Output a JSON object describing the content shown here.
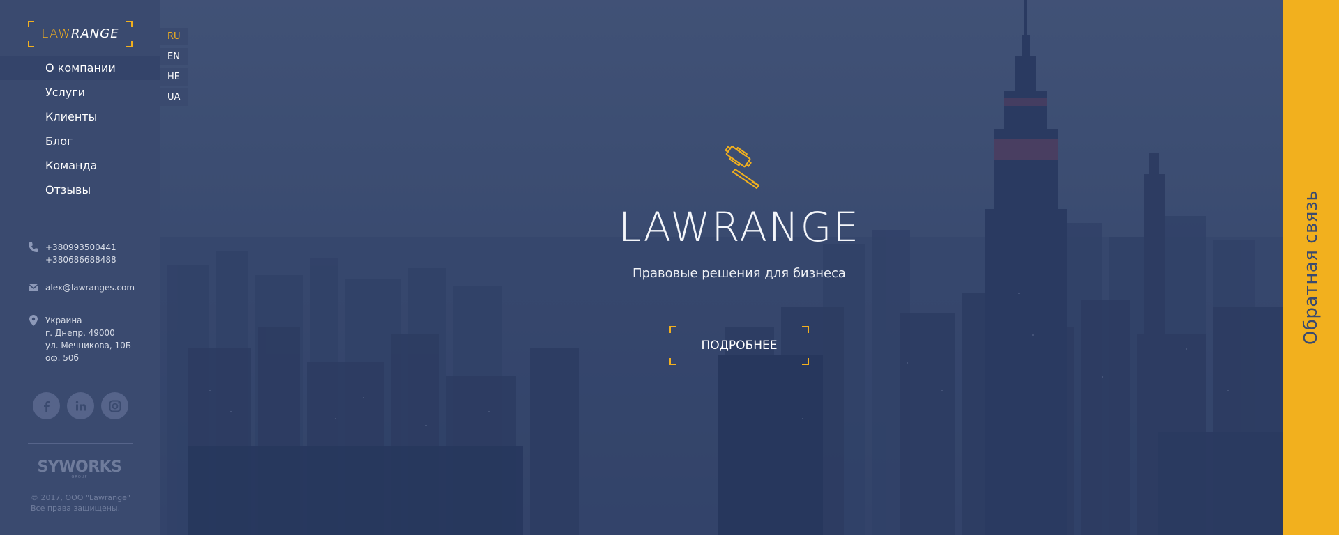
{
  "logo": {
    "part1": "LAW",
    "part2": "RANGE"
  },
  "nav": {
    "items": [
      {
        "label": "О компании",
        "active": true
      },
      {
        "label": "Услуги"
      },
      {
        "label": "Клиенты"
      },
      {
        "label": "Блог"
      },
      {
        "label": "Команда"
      },
      {
        "label": "Отзывы"
      }
    ]
  },
  "languages": [
    {
      "code": "RU",
      "active": true
    },
    {
      "code": "EN"
    },
    {
      "code": "HE"
    },
    {
      "code": "UA"
    }
  ],
  "contacts": {
    "phone1": "+380993500441",
    "phone2": "+380686688488",
    "email": "alex@lawranges.com",
    "address": [
      "Украина",
      "г. Днепр, 49000",
      "ул. Мечникова, 10Б",
      "оф. 50б"
    ]
  },
  "social": [
    {
      "name": "facebook",
      "icon": "facebook-icon"
    },
    {
      "name": "linkedin",
      "icon": "linkedin-icon"
    },
    {
      "name": "instagram",
      "icon": "instagram-icon"
    }
  ],
  "footer": {
    "brand": "SYWORKS",
    "brand_sub": "GROUP",
    "copyright_line1": "© 2017, ООО \"Lawrange\"",
    "copyright_line2": "Все права защищены."
  },
  "hero": {
    "icon": "gavel-icon",
    "title": "LAWRANGE",
    "subtitle": "Правовые решения для бизнеса",
    "button": "ПОДРОБНЕЕ"
  },
  "feedback": {
    "label": "Обратная связь"
  },
  "colors": {
    "accent": "#f2b01e",
    "sidebar": "#3a4a6f",
    "overlay": "#2c3c64"
  }
}
